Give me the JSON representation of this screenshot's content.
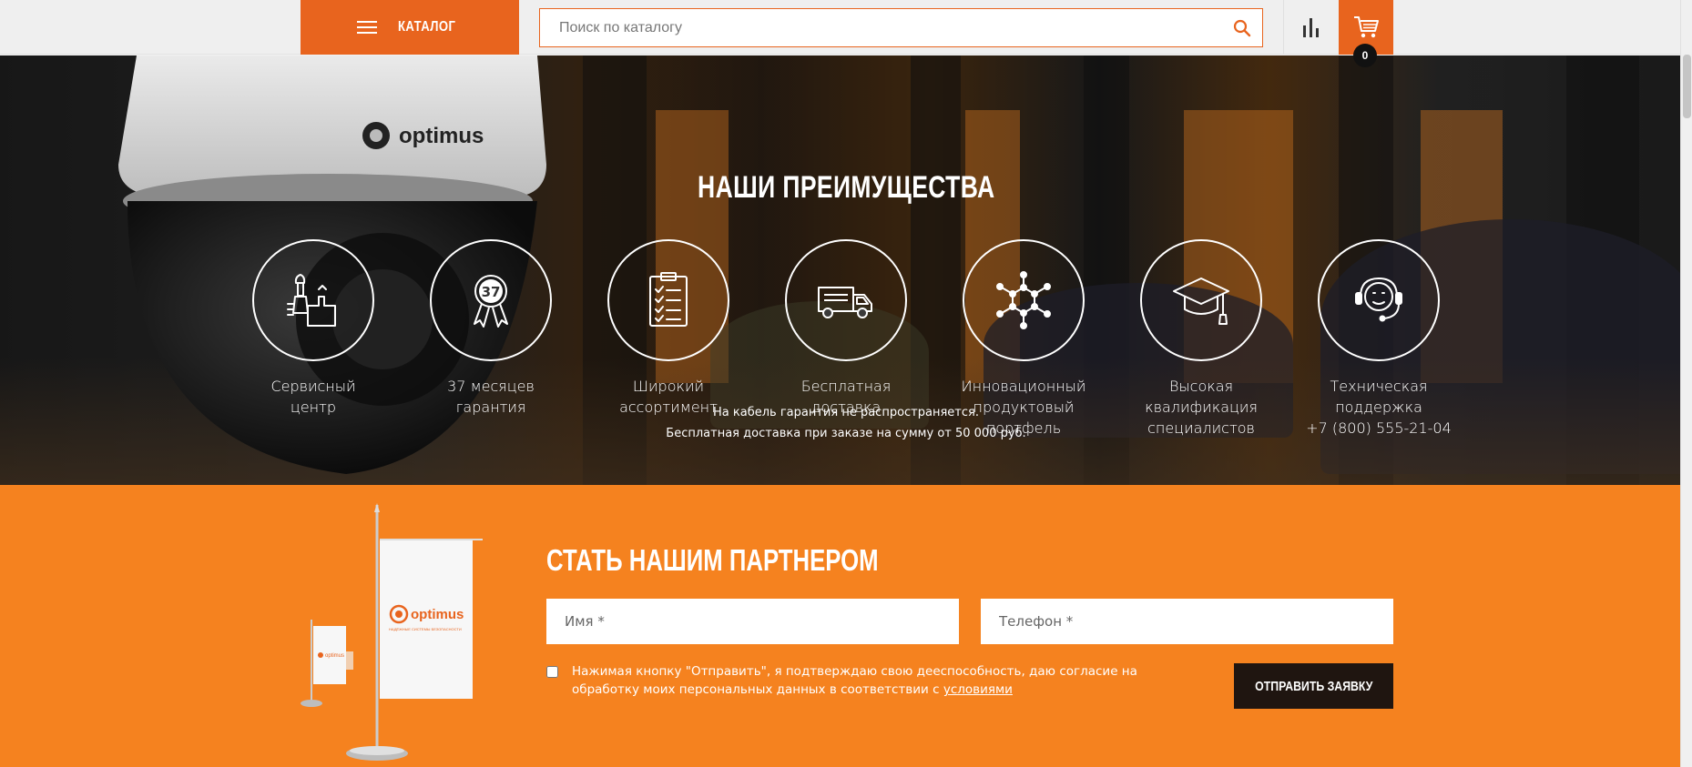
{
  "header": {
    "catalog_label": "КАТАЛОГ",
    "search_placeholder": "Поиск по каталогу",
    "cart_count": "0",
    "icons": {
      "menu": "burger-icon",
      "search": "search-icon",
      "compare": "bar-chart-icon",
      "cart": "cart-icon"
    }
  },
  "hero": {
    "brand": "optimus",
    "title": "НАШИ ПРЕИМУЩЕСТВА",
    "advantages": [
      {
        "icon": "service-tools-icon",
        "lines": [
          "Сервисный",
          "центр"
        ]
      },
      {
        "icon": "warranty-badge-icon",
        "badge": "37",
        "lines": [
          "37 месяцев",
          "гарантия"
        ]
      },
      {
        "icon": "checklist-icon",
        "lines": [
          "Широкий",
          "ассортимент"
        ]
      },
      {
        "icon": "truck-icon",
        "lines": [
          "Бесплатная",
          "доставка"
        ]
      },
      {
        "icon": "molecule-icon",
        "lines": [
          "Инновационный",
          "продуктовый",
          "портфель"
        ]
      },
      {
        "icon": "graduation-cap-icon",
        "lines": [
          "Высокая",
          "квалификация",
          "специалистов"
        ]
      },
      {
        "icon": "support-headset-icon",
        "lines": [
          "Техническая",
          "поддержка",
          "+7 (800) 555-21-04"
        ]
      }
    ],
    "notes": [
      "На кабель гарантия не распространяется.",
      "Бесплатная доставка при заказе на сумму от 50 000 руб."
    ]
  },
  "partner": {
    "title": "СТАТЬ НАШИМ ПАРТНЕРОМ",
    "name_placeholder": "Имя *",
    "phone_placeholder": "Телефон *",
    "consent_text": "Нажимая кнопку \"Отправить\", я подтверждаю свою дееспособность, даю согласие на обработку моих персональных данных в соответствии с ",
    "consent_link": "условиями",
    "submit_label": "ОТПРАВИТЬ ЗАЯВКУ",
    "flag_brand": "optimus",
    "flag_tagline": "НАДЁЖНЫЕ СИСТЕМЫ БЕЗОПАСНОСТИ"
  },
  "colors": {
    "accent": "#e8641e",
    "partner_bg": "#f5821f",
    "button_dark": "#1f1510"
  }
}
